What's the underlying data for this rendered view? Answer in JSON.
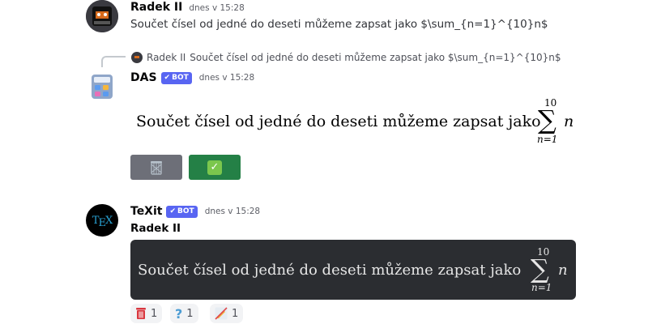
{
  "messages": [
    {
      "author": "Radek II",
      "timestamp": "dnes v 15:28",
      "text": "Součet čísel od jedné do deseti můžeme zapsat jako $\\sum_{n=1}^{10}n$"
    },
    {
      "reply": {
        "author": "Radek II",
        "text": "Součet čísel od jedné do deseti můžeme zapsat jako $\\sum_{n=1}^{10}n$"
      },
      "author": "DAS",
      "badge": "BOT",
      "timestamp": "dnes v 15:28",
      "rendered": {
        "prefix": "Součet čísel od jedné do deseti můžeme zapsat jako",
        "sum_upper": "10",
        "sum_lower": "n=1",
        "sum_symbol": "∑",
        "sum_variable": "n"
      },
      "buttons": [
        {
          "icon": "wastebasket-icon",
          "color": "#6d6f78"
        },
        {
          "icon": "check-mark-button-icon",
          "label": "✅",
          "color": "#248046"
        }
      ]
    },
    {
      "author": "TeXit",
      "badge": "BOT",
      "timestamp": "dnes v 15:28",
      "subheader": "Radek II",
      "rendered": {
        "prefix": "Součet čísel od jedné do deseti můžeme zapsat jako",
        "sum_upper": "10",
        "sum_lower": "n=1",
        "sum_symbol": "∑",
        "sum_variable": "n"
      },
      "reactions": [
        {
          "icon": "wastebasket-icon",
          "count": "1"
        },
        {
          "icon": "question-mark-icon",
          "label": "?",
          "count": "1"
        },
        {
          "icon": "crossed-pencil-icon",
          "count": "1"
        }
      ]
    }
  ],
  "avatars": {
    "texit_logo": "TEX"
  },
  "colors": {
    "bot_badge": "#5865f2",
    "secondary_button": "#6d6f78",
    "success_button": "#248046",
    "latex_box": "#2b2d31"
  }
}
